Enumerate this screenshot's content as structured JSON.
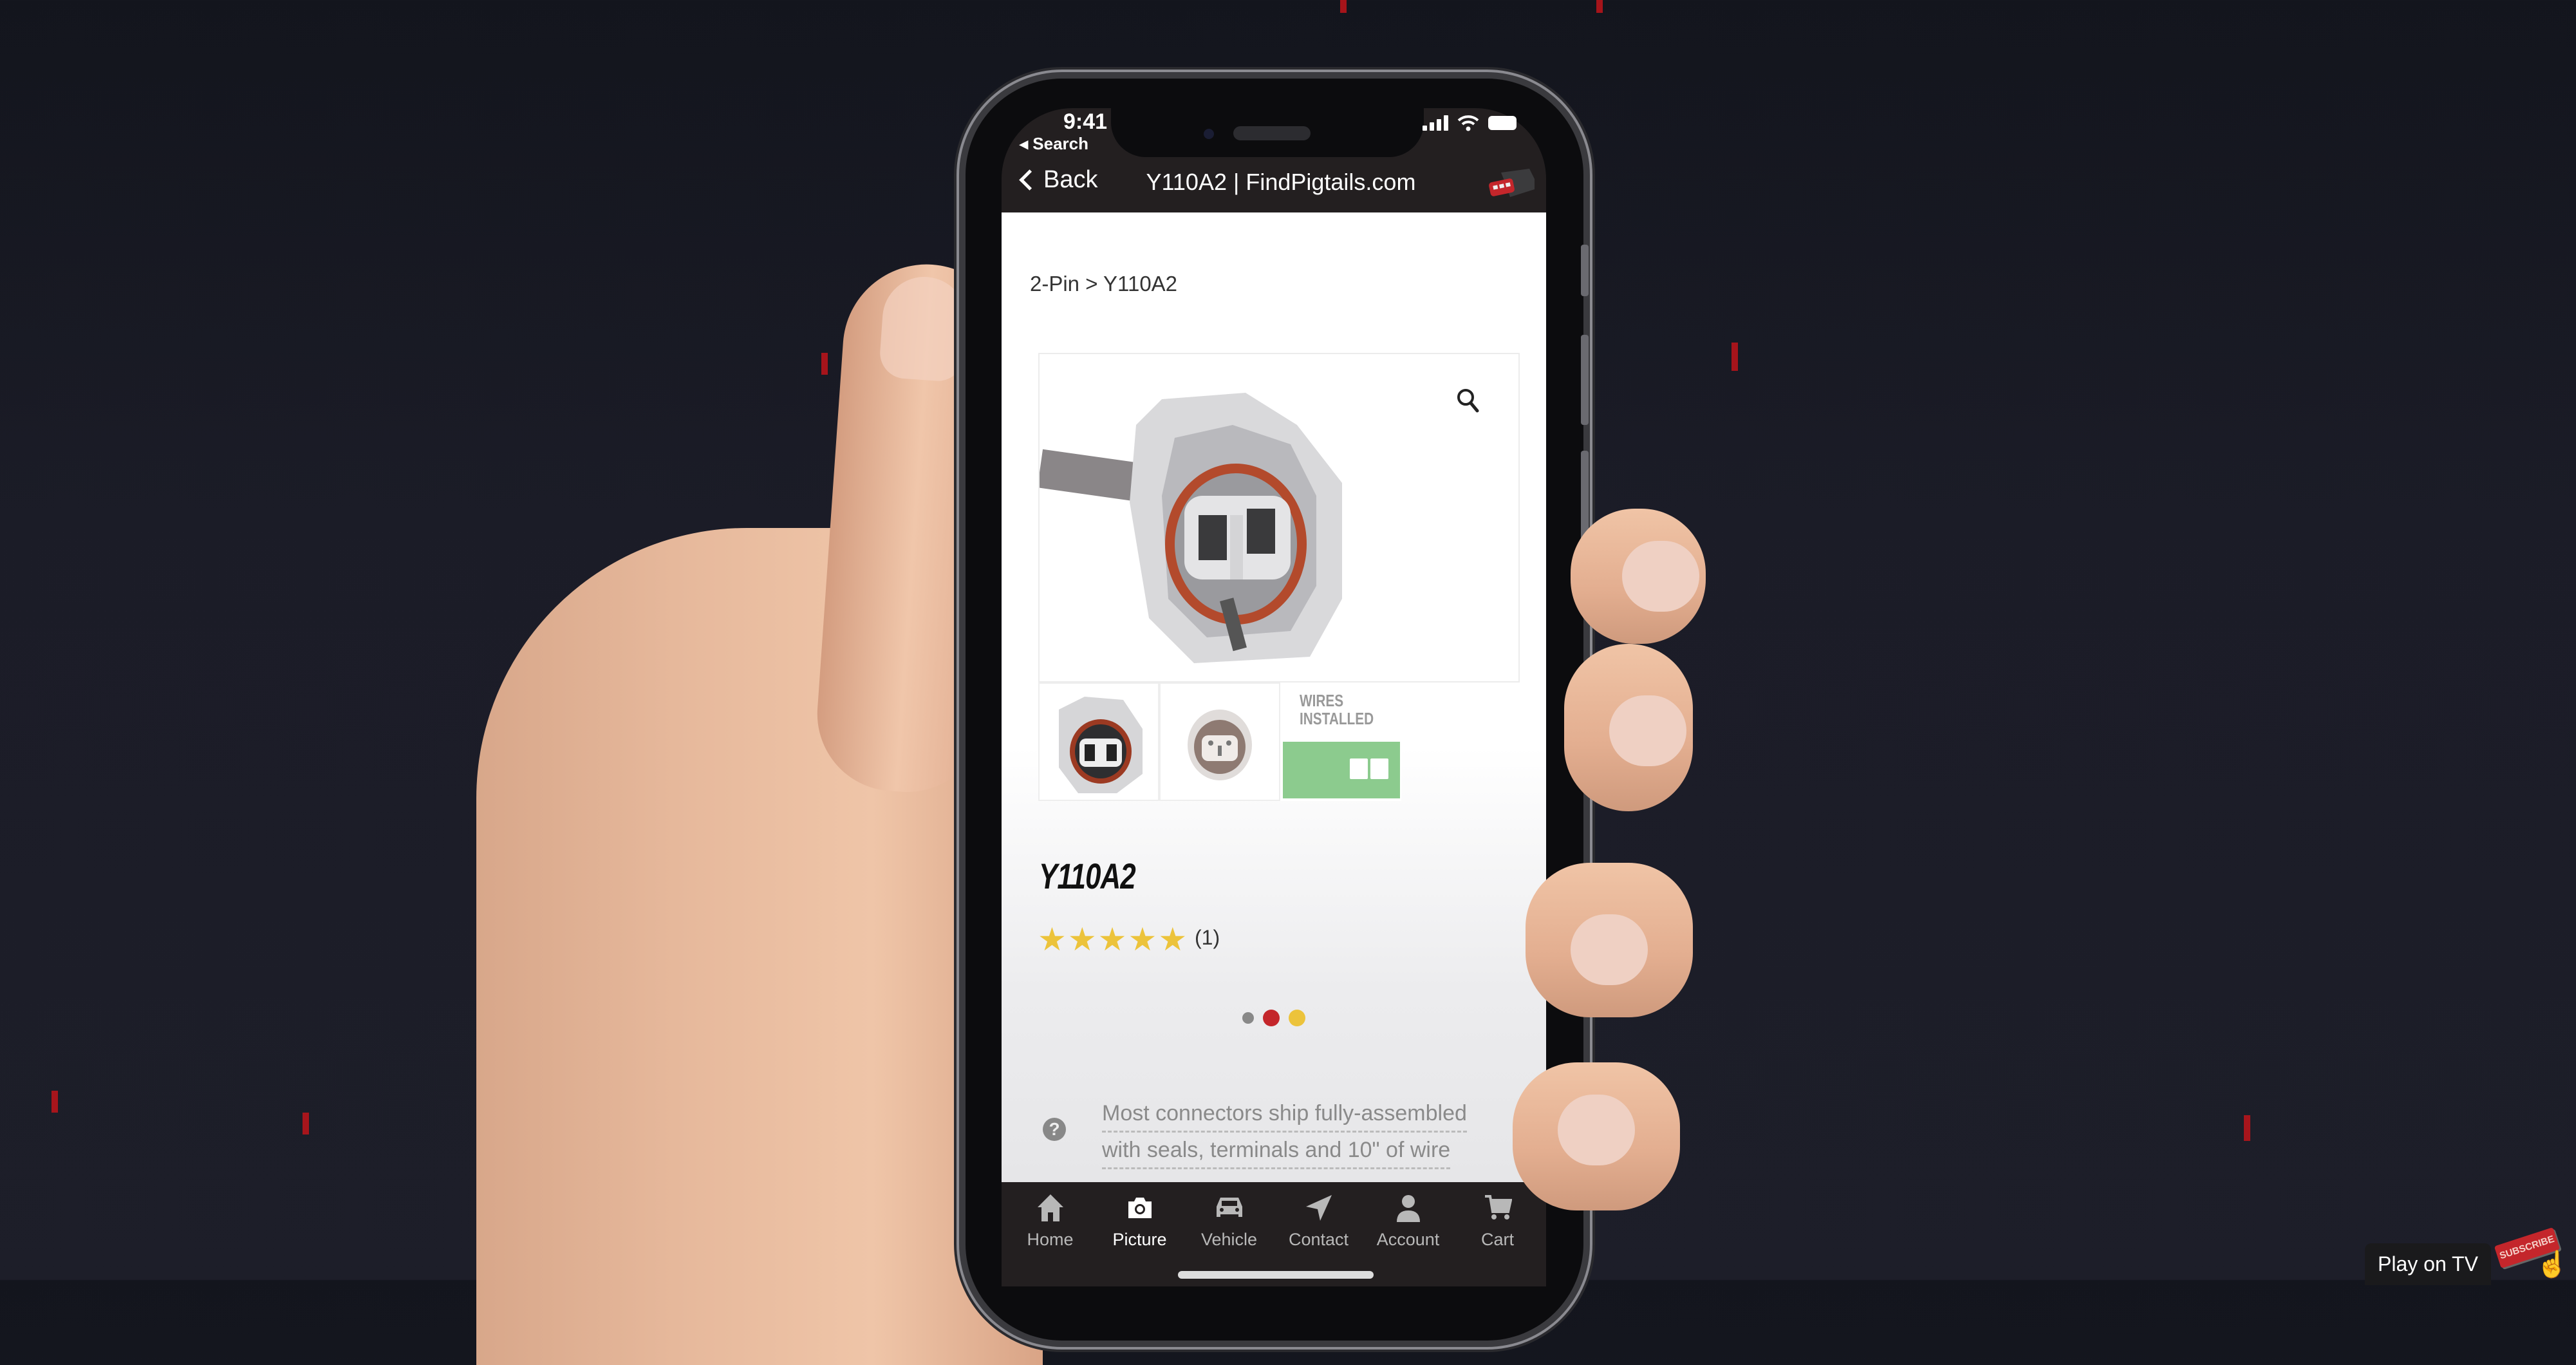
{
  "status_bar": {
    "time": "9:41",
    "back_to_app": "◂ Search"
  },
  "nav": {
    "back_label": "Back",
    "title": "Y110A2 | FindPigtails.com"
  },
  "breadcrumb": "2-Pin > Y110A2",
  "product": {
    "name": "Y110A2",
    "rating": 5,
    "rating_max": 5,
    "star_glyph": "★",
    "review_count": "(1)",
    "thumbnails": [
      {
        "alt": "connector-front"
      },
      {
        "alt": "connector-rear"
      },
      {
        "alt": "wires-installed",
        "text_line1": "WIRES",
        "text_line2": "INSTALLED"
      }
    ],
    "color_options": [
      {
        "name": "gray",
        "color": "#888888"
      },
      {
        "name": "red",
        "color": "#c4262b",
        "selected": true
      },
      {
        "name": "yellow",
        "color": "#ecc33b"
      }
    ],
    "help_glyph": "?",
    "notice_line1": "Most connectors ship fully-assembled",
    "notice_line2": "with seals, terminals and 10\" of wire"
  },
  "tabbar": {
    "active": "Picture",
    "tabs": [
      {
        "label": "Home",
        "icon": "home-icon"
      },
      {
        "label": "Picture",
        "icon": "camera-icon"
      },
      {
        "label": "Vehicle",
        "icon": "car-icon"
      },
      {
        "label": "Contact",
        "icon": "send-icon"
      },
      {
        "label": "Account",
        "icon": "person-icon"
      },
      {
        "label": "Cart",
        "icon": "cart-icon"
      }
    ]
  },
  "video_overlay": {
    "play_on_tv": "Play on TV",
    "subscribe": "SUBSCRIBE"
  },
  "colors": {
    "nav_bg": "#231f20",
    "accent_red": "#c4262b",
    "star_yellow": "#ecc33b",
    "wires_green": "#8ccb8e"
  }
}
